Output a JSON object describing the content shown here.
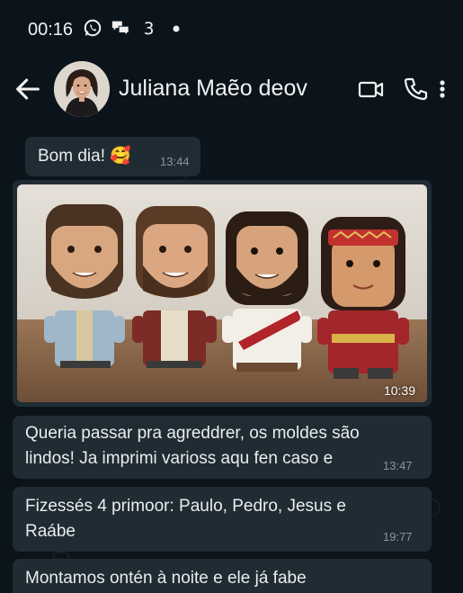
{
  "status_bar": {
    "time": "00:16",
    "icons": [
      "whatsapp-icon",
      "chat-bubbles-icon",
      "notification-icon",
      "dot-icon"
    ],
    "glyph_label": "3"
  },
  "header": {
    "contact_name": "Juliana Maẽo deov",
    "icons": [
      "back-arrow-icon",
      "video-call-icon",
      "phone-icon",
      "more-options-icon"
    ]
  },
  "messages": [
    {
      "text": "Bom dia! 🥰",
      "time": "13:44"
    },
    {
      "type": "image",
      "time": "10:39",
      "description_icons": [
        "figurine-paulo",
        "figurine-pedro",
        "figurine-jesus",
        "figurine-raabe"
      ]
    },
    {
      "text_line1": "Queria passar pra agreddrer, os moldes são",
      "text_line2": "lindos! Ja imprimi varioss aqu fen caso e",
      "time": "13:47"
    },
    {
      "text_line1": "Fizessés 4 primoor: Paulo, Pedro, Jesus e",
      "text_line2": "Raábe",
      "time": "19:77"
    },
    {
      "text_line1": "Montamos ontén à noite e ele já fabe"
    }
  ],
  "colors": {
    "background": "#0b141a",
    "bubble": "#202c33",
    "text": "#e9edef",
    "time": "#8696a0"
  }
}
